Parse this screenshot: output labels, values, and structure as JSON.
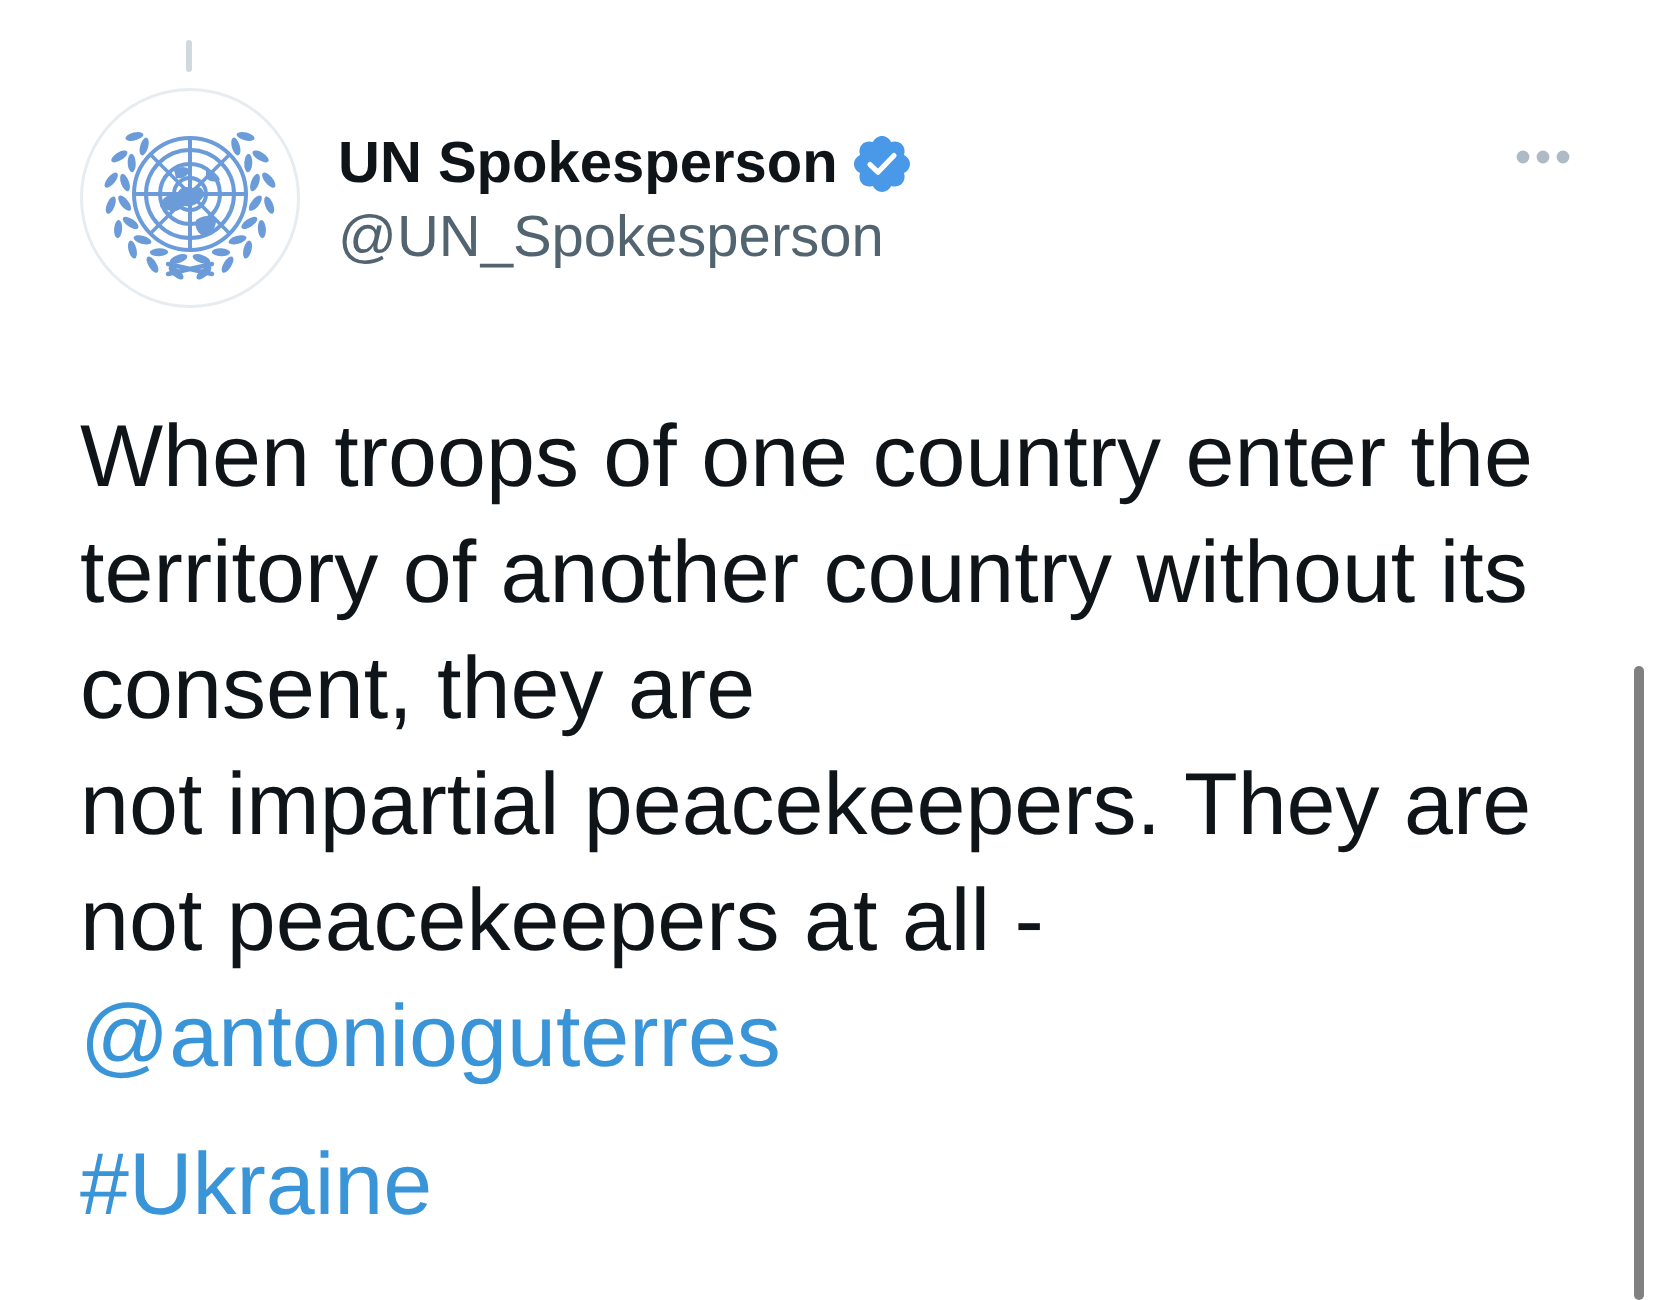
{
  "tweet": {
    "author": {
      "name": "UN Spokesperson",
      "verified": true,
      "handle": "@UN_Spokesperson"
    },
    "text": "When troops of one country enter the territory of another country without its consent, they are\nnot impartial peacekeepers. They are not peacekeepers at all -",
    "mention": "@antonioguterres",
    "hashtag": "#Ukraine"
  }
}
